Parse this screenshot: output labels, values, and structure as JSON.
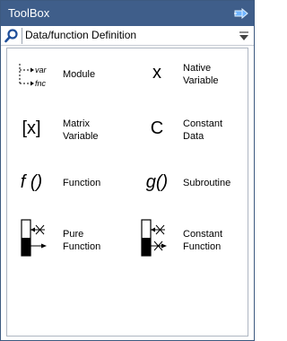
{
  "window": {
    "title": "ToolBox"
  },
  "search": {
    "value": "Data/function Definition"
  },
  "tools": {
    "module": {
      "label": "Module",
      "var_text": "var",
      "fnc_text": "fnc"
    },
    "native_variable": {
      "label": "Native\nVariable",
      "symbol": "x"
    },
    "matrix_variable": {
      "label": "Matrix\nVariable",
      "symbol": "[x]"
    },
    "constant_data": {
      "label": "Constant\nData",
      "symbol": "C"
    },
    "function": {
      "label": "Function",
      "symbol": "f ()"
    },
    "subroutine": {
      "label": "Subroutine",
      "symbol": "g()"
    },
    "pure_function": {
      "label": "Pure\nFunction"
    },
    "constant_function": {
      "label": "Constant\nFunction"
    }
  },
  "colors": {
    "titlebar": "#3f5e8a",
    "accent": "#2f6fd0"
  }
}
